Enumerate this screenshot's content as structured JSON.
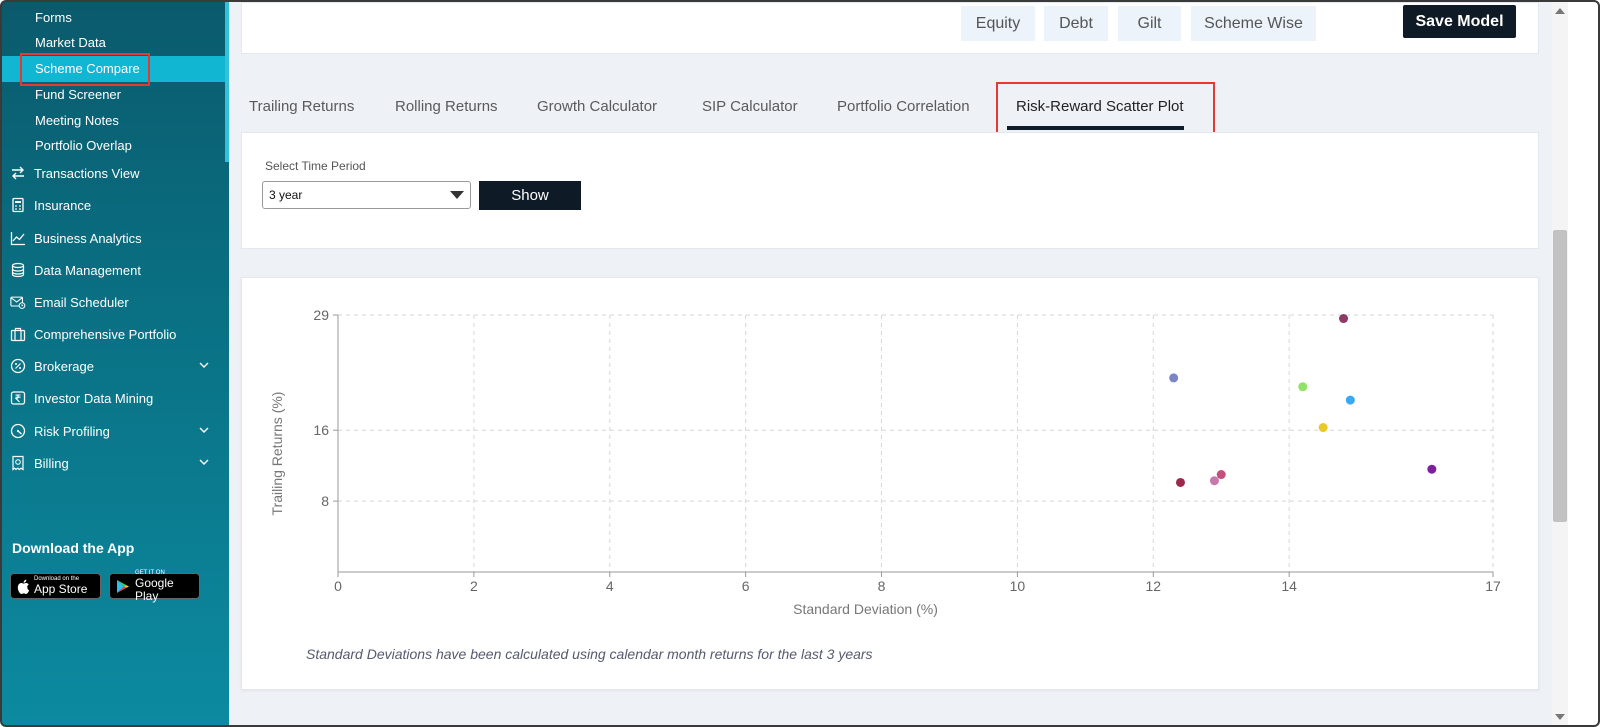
{
  "sidebar": {
    "sub_items": [
      {
        "label": "Forms",
        "active": false
      },
      {
        "label": "Market Data",
        "active": false
      },
      {
        "label": "Scheme Compare",
        "active": true
      },
      {
        "label": "Fund Screener",
        "active": false
      },
      {
        "label": "Meeting Notes",
        "active": false
      },
      {
        "label": "Portfolio Overlap",
        "active": false
      }
    ],
    "nav_items": [
      {
        "label": "Transactions View",
        "icon": "arrows-swap-icon",
        "chevron": false
      },
      {
        "label": "Insurance",
        "icon": "calculator-doc-icon",
        "chevron": false
      },
      {
        "label": "Business Analytics",
        "icon": "line-chart-icon",
        "chevron": false
      },
      {
        "label": "Data Management",
        "icon": "database-icon",
        "chevron": false
      },
      {
        "label": "Email Scheduler",
        "icon": "email-clock-icon",
        "chevron": false
      },
      {
        "label": "Comprehensive Portfolio",
        "icon": "briefcase-icon",
        "chevron": false
      },
      {
        "label": "Brokerage",
        "icon": "percent-icon",
        "chevron": true
      },
      {
        "label": "Investor Data Mining",
        "icon": "rupee-icon",
        "chevron": false
      },
      {
        "label": "Risk Profiling",
        "icon": "gauge-icon",
        "chevron": true
      },
      {
        "label": "Billing",
        "icon": "receipt-icon",
        "chevron": true
      }
    ],
    "download_title": "Download the App",
    "app_store": {
      "small": "Download on the",
      "big": "App Store"
    },
    "google_play": {
      "small": "GET IT ON",
      "big": "Google Play"
    }
  },
  "top": {
    "type_buttons": [
      "Equity",
      "Debt",
      "Gilt",
      "Scheme Wise"
    ],
    "save_label": "Save Model"
  },
  "tabs": [
    {
      "label": "Trailing Returns",
      "active": false
    },
    {
      "label": "Rolling Returns",
      "active": false
    },
    {
      "label": "Growth Calculator",
      "active": false
    },
    {
      "label": "SIP Calculator",
      "active": false
    },
    {
      "label": "Portfolio Correlation",
      "active": false
    },
    {
      "label": "Risk-Reward Scatter Plot",
      "active": true
    }
  ],
  "filter": {
    "label": "Select Time Period",
    "selected": "3 year",
    "show_label": "Show"
  },
  "chart_data": {
    "type": "scatter",
    "xlabel": "Standard Deviation (%)",
    "ylabel": "Trailing Returns (%)",
    "xlim": [
      0,
      17
    ],
    "ylim": [
      0,
      29
    ],
    "x_ticks": [
      "0",
      "2",
      "4",
      "6",
      "8",
      "10",
      "12",
      "14",
      "17"
    ],
    "y_ticks": [
      "8",
      "16",
      "29"
    ],
    "grid": true,
    "points": [
      {
        "x": 12.3,
        "y": 21.9,
        "color": "#7b86c7"
      },
      {
        "x": 14.8,
        "y": 28.6,
        "color": "#8b3a6a"
      },
      {
        "x": 14.2,
        "y": 20.9,
        "color": "#8fe26a"
      },
      {
        "x": 14.9,
        "y": 19.4,
        "color": "#38a9f0"
      },
      {
        "x": 14.5,
        "y": 16.3,
        "color": "#e8c92a"
      },
      {
        "x": 16.1,
        "y": 11.6,
        "color": "#7d1fa0"
      },
      {
        "x": 12.4,
        "y": 10.1,
        "color": "#9b2a4a"
      },
      {
        "x": 12.9,
        "y": 10.3,
        "color": "#c77aa8"
      },
      {
        "x": 13.0,
        "y": 11.0,
        "color": "#c2507a"
      }
    ]
  },
  "chart_note": "Standard Deviations have been calculated using calendar month returns for the last 3 years"
}
